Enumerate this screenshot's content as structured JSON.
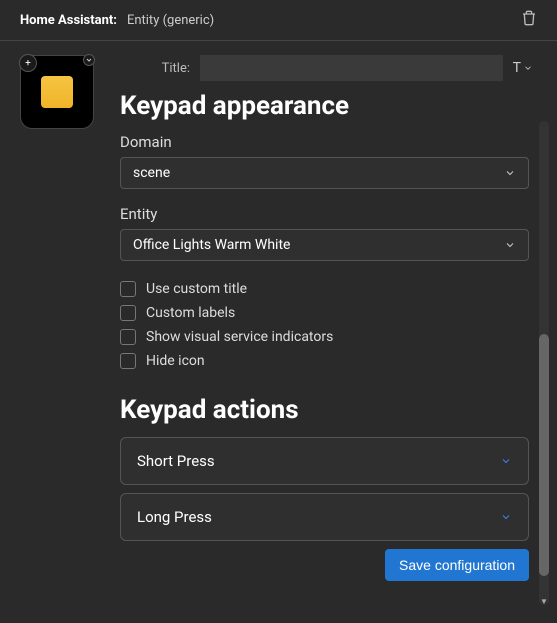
{
  "header": {
    "app": "Home Assistant:",
    "subtitle": "Entity (generic)"
  },
  "tile": {
    "icon": "yellow-square-icon"
  },
  "titleRow": {
    "label": "Title:",
    "value": "",
    "typeBadge": "T"
  },
  "section1": {
    "heading": "Keypad appearance",
    "domain": {
      "label": "Domain",
      "value": "scene"
    },
    "entity": {
      "label": "Entity",
      "value": "Office Lights Warm White"
    },
    "checks": [
      {
        "label": "Use custom title",
        "checked": false
      },
      {
        "label": "Custom labels",
        "checked": false
      },
      {
        "label": "Show visual service indicators",
        "checked": false
      },
      {
        "label": "Hide icon",
        "checked": false
      }
    ]
  },
  "section2": {
    "heading": "Keypad actions",
    "items": [
      {
        "label": "Short Press"
      },
      {
        "label": "Long Press"
      }
    ]
  },
  "footer": {
    "save": "Save configuration"
  }
}
